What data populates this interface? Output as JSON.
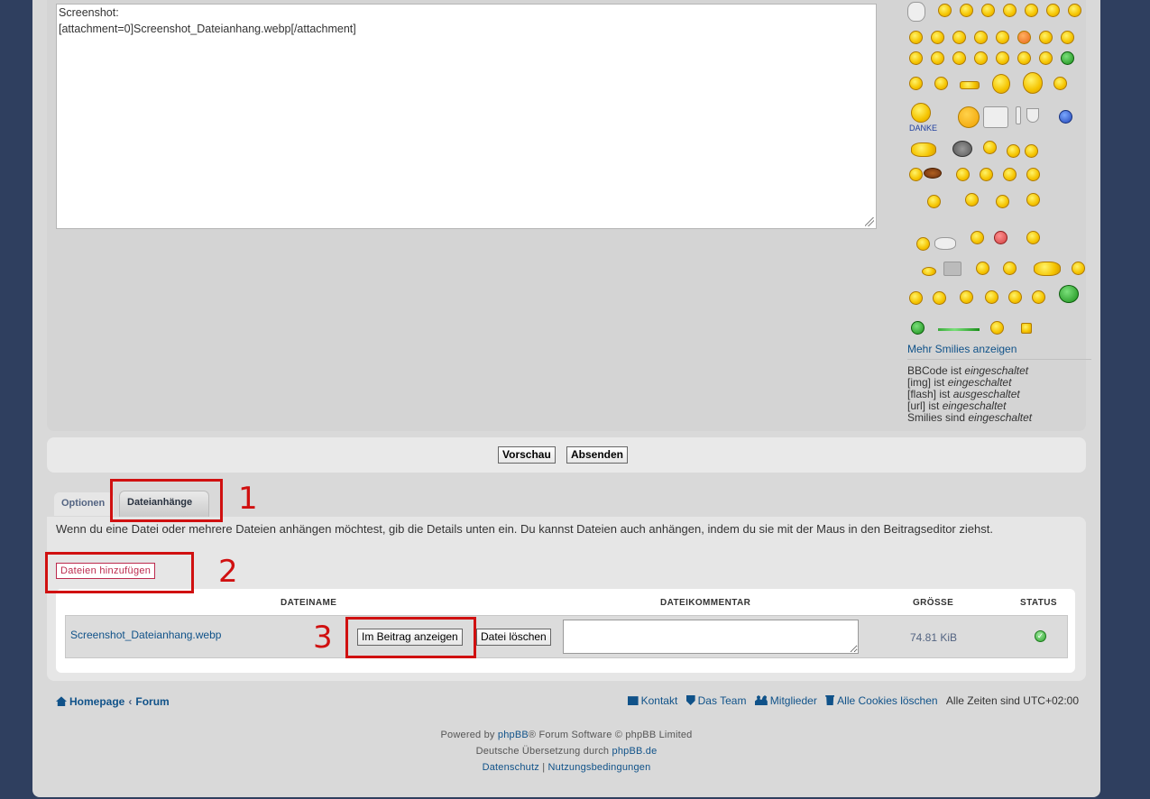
{
  "editor": {
    "lines": [
      "Screenshot:",
      "[attachment=0]Screenshot_Dateianhang.webp[/attachment]"
    ]
  },
  "smilies": {
    "danke_label": "DANKE",
    "more_label": "Mehr Smilies anzeigen"
  },
  "bbcode_status": [
    {
      "name": "BBCode",
      "verb": "ist",
      "state": "eingeschaltet"
    },
    {
      "name": "[img]",
      "verb": "ist",
      "state": "eingeschaltet"
    },
    {
      "name": "[flash]",
      "verb": "ist",
      "state": "ausgeschaltet"
    },
    {
      "name": "[url]",
      "verb": "ist",
      "state": "eingeschaltet"
    },
    {
      "name": "Smilies",
      "verb": "sind",
      "state": "eingeschaltet"
    }
  ],
  "submit": {
    "preview_label": "Vorschau",
    "send_label": "Absenden"
  },
  "tabs": [
    {
      "label": "Optionen",
      "active": false
    },
    {
      "label": "Dateianhänge",
      "active": true
    }
  ],
  "attachments": {
    "description": "Wenn du eine Datei oder mehrere Dateien anhängen möchtest, gib die Details unten ein. Du kannst Dateien auch anhängen, indem du sie mit der Maus in den Beitragseditor ziehst.",
    "add_files_label": "Dateien hinzufügen",
    "columns": [
      "DATEINAME",
      "DATEIKOMMENTAR",
      "GRÖSSE",
      "STATUS"
    ],
    "files": [
      {
        "name": "Screenshot_Dateianhang.webp",
        "show_in_post_label": "Im Beitrag anzeigen",
        "delete_label": "Datei löschen",
        "comment": "",
        "size": "74.81 KiB",
        "status": "success"
      }
    ]
  },
  "annotations": [
    "1",
    "2",
    "3"
  ],
  "annotation_color": "#d01010",
  "footer": {
    "breadcrumbs": [
      "Homepage",
      "Forum"
    ],
    "links": [
      "Kontakt",
      "Das Team",
      "Mitglieder",
      "Alle Cookies löschen"
    ],
    "timezone": "Alle Zeiten sind UTC+02:00",
    "powered_prefix": "Powered by",
    "powered_brand": "phpBB",
    "powered_suffix": "® Forum Software © phpBB Limited",
    "translation_prefix": "Deutsche Übersetzung durch",
    "translation_link": "phpBB.de",
    "privacy_label": "Datenschutz",
    "separator": "|",
    "terms_label": "Nutzungsbedingungen"
  },
  "colors": {
    "background": "#2f3f5f",
    "link": "#105289",
    "accent_red": "#bc2a4d"
  }
}
